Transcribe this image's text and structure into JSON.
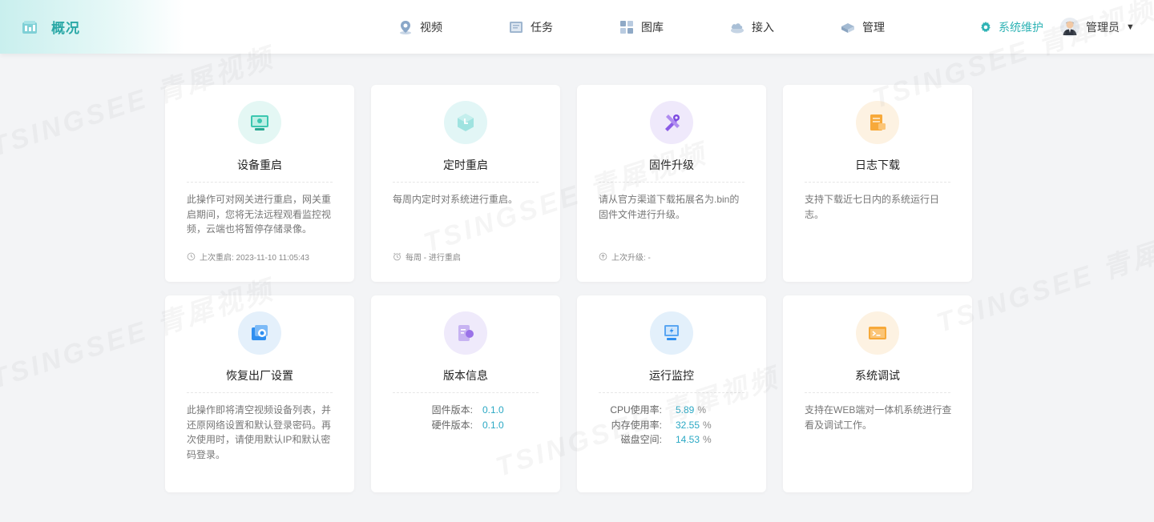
{
  "header": {
    "title": "概况",
    "nav": [
      {
        "label": "视频",
        "icon": "map-pin-icon"
      },
      {
        "label": "任务",
        "icon": "task-icon"
      },
      {
        "label": "图库",
        "icon": "gallery-icon"
      },
      {
        "label": "接入",
        "icon": "cloud-access-icon"
      },
      {
        "label": "管理",
        "icon": "manage-icon"
      }
    ],
    "system_maintenance": "系统维护",
    "user": "管理员"
  },
  "watermark": "TSINGSEE 青犀视频",
  "cards": [
    {
      "title": "设备重启",
      "desc": "此操作可对网关进行重启，网关重启期间，您将无法远程观看监控视频，云端也将暂停存储录像。",
      "footer": "上次重启: 2023-11-10 11:05:43",
      "icon": "device-restart-icon",
      "color": "#e4f7f4"
    },
    {
      "title": "定时重启",
      "desc": "每周内定时对系统进行重启。",
      "footer": "每周 - 进行重启",
      "icon": "scheduled-restart-icon",
      "color": "#e2f6f6"
    },
    {
      "title": "固件升级",
      "desc": "请从官方渠道下载拓展名为.bin的固件文件进行升级。",
      "footer": "上次升级: -",
      "icon": "firmware-upgrade-icon",
      "color": "#efe9fb"
    },
    {
      "title": "日志下载",
      "desc": "支持下载近七日内的系统运行日志。",
      "footer": "",
      "icon": "log-download-icon",
      "color": "#fdf2e2"
    },
    {
      "title": "恢复出厂设置",
      "desc": "此操作即将清空视频设备列表，并还原网络设置和默认登录密码。再次使用时，请使用默认IP和默认密码登录。",
      "footer": "",
      "icon": "factory-reset-icon",
      "color": "#e4f0fb"
    },
    {
      "title": "版本信息",
      "desc": "",
      "footer": "",
      "icon": "version-info-icon",
      "color": "#efeafb"
    },
    {
      "title": "运行监控",
      "desc": "",
      "footer": "",
      "icon": "run-monitor-icon",
      "color": "#e3f0fb"
    },
    {
      "title": "系统调试",
      "desc": "支持在WEB端对一体机系统进行查看及调试工作。",
      "footer": "",
      "icon": "system-debug-icon",
      "color": "#fdf2e2"
    }
  ],
  "version_info": [
    {
      "label": "固件版本:",
      "value": "0.1.0"
    },
    {
      "label": "硬件版本:",
      "value": "0.1.0"
    }
  ],
  "monitor": [
    {
      "label": "CPU使用率:",
      "value": "5.89",
      "unit": "%"
    },
    {
      "label": "内存使用率:",
      "value": "32.55",
      "unit": "%"
    },
    {
      "label": "磁盘空间:",
      "value": "14.53",
      "unit": "%"
    }
  ]
}
